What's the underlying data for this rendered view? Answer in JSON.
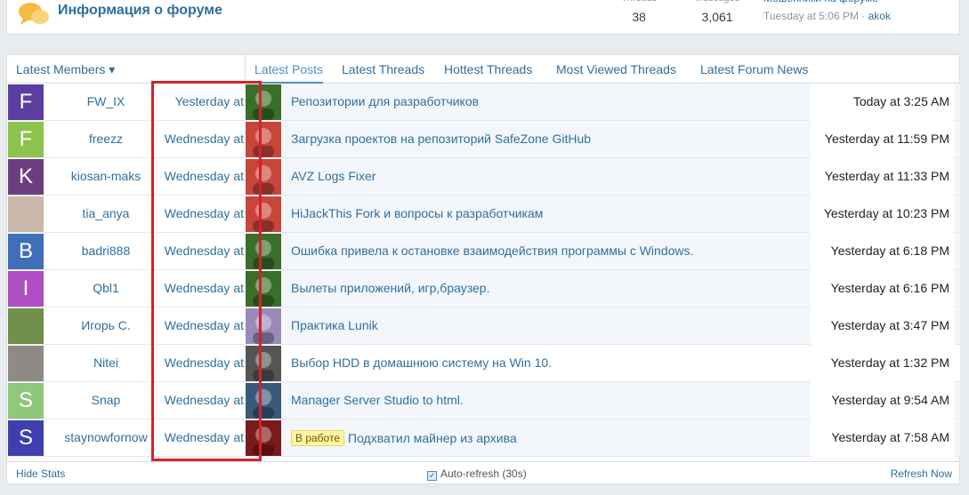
{
  "header": {
    "forum_title": "Информация о форуме",
    "stats": [
      {
        "label": "Threads",
        "value": "38"
      },
      {
        "label": "Messages",
        "value": "3,061"
      }
    ],
    "last_post": {
      "title": "Мошенники на форуме",
      "meta": "Tuesday at 5:06 PM · ",
      "user": "akok"
    }
  },
  "members": {
    "tab_label": "Latest Members ▾",
    "rows": [
      {
        "initial": "F",
        "color": "#5a3fa0",
        "name": "FW_IX",
        "date": "Yesterday at"
      },
      {
        "initial": "F",
        "color": "#8cc34a",
        "name": "freezz",
        "date": "Wednesday at"
      },
      {
        "initial": "K",
        "color": "#6b3f7f",
        "name": "kiosan-maks",
        "date": "Wednesday at"
      },
      {
        "initial": "",
        "color": "#c9b8a8",
        "name": "tia_anya",
        "date": "Wednesday at"
      },
      {
        "initial": "B",
        "color": "#3f6fb8",
        "name": "badri888",
        "date": "Wednesday at"
      },
      {
        "initial": "I",
        "color": "#b04fc4",
        "name": "Qbl1",
        "date": "Wednesday at"
      },
      {
        "initial": "",
        "color": "#6f8f4a",
        "name": "Игорь С.",
        "date": "Wednesday at"
      },
      {
        "initial": "",
        "color": "#8f8a86",
        "name": "Nitei",
        "date": "Wednesday at"
      },
      {
        "initial": "S",
        "color": "#8fc87a",
        "name": "Snap",
        "date": "Wednesday at"
      },
      {
        "initial": "S",
        "color": "#3f3fb0",
        "name": "staynowfornow",
        "date": "Wednesday at"
      }
    ]
  },
  "tabs": [
    "Latest Posts",
    "Latest Threads",
    "Hottest Threads",
    "Most Viewed Threads",
    "Latest Forum News"
  ],
  "posts": [
    {
      "title": "Репозитории для разработчиков",
      "time": "Today at 3:25 AM",
      "badge": ""
    },
    {
      "title": "Загрузка проектов на репозиторий SafeZone GitHub",
      "time": "Yesterday at 11:59 PM",
      "badge": ""
    },
    {
      "title": "AVZ Logs Fixer",
      "time": "Yesterday at 11:33 PM",
      "badge": ""
    },
    {
      "title": "HiJackThis Fork и вопросы к разработчикам",
      "time": "Yesterday at 10:23 PM",
      "badge": ""
    },
    {
      "title": "Ошибка привела к остановке взаимодействия программы с Windows.",
      "time": "Yesterday at 6:18 PM",
      "badge": ""
    },
    {
      "title": "Вылеты приложений, игр,браузер.",
      "time": "Yesterday at 6:16 PM",
      "badge": ""
    },
    {
      "title": "Практика Lunik",
      "time": "Yesterday at 3:47 PM",
      "badge": ""
    },
    {
      "title": "Выбор HDD в домашнюю систему на Win 10.",
      "time": "Yesterday at 1:32 PM",
      "badge": ""
    },
    {
      "title": "Manager Server Studio to html.",
      "time": "Yesterday at 9:54 AM",
      "badge": ""
    },
    {
      "title": "Подхватил майнер из архива",
      "time": "Yesterday at 7:58 AM",
      "badge": "В работе"
    }
  ],
  "footer": {
    "hide_stats": "Hide Stats",
    "autorefresh": "Auto-refresh (30s)",
    "refresh_now": "Refresh Now"
  }
}
